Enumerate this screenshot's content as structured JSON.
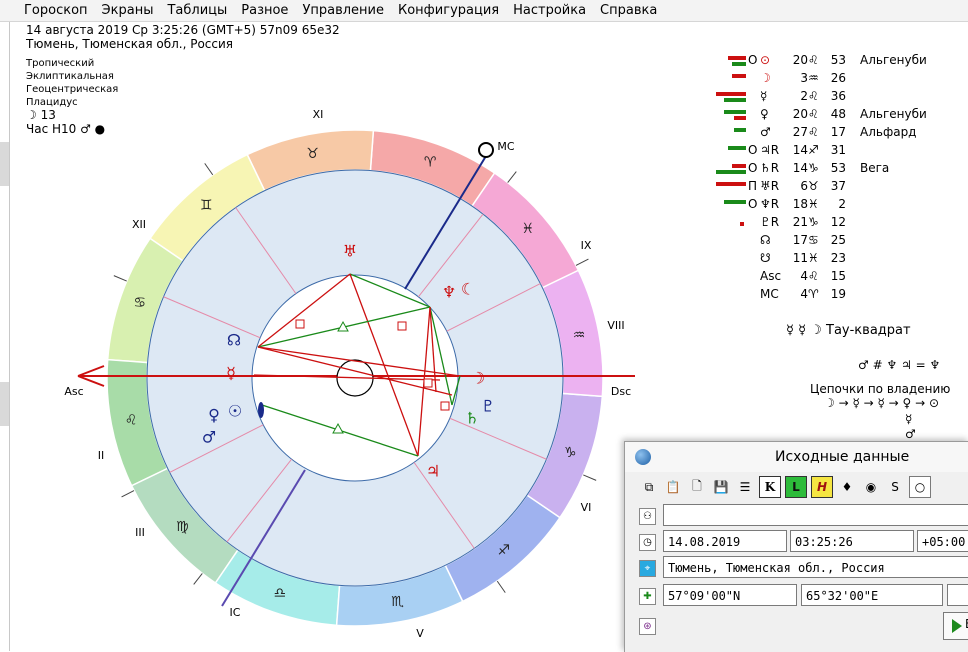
{
  "menu": [
    "Гороскоп",
    "Экраны",
    "Таблицы",
    "Разное",
    "Управление",
    "Конфигурация",
    "Настройка",
    "Справка"
  ],
  "header": {
    "line1": "14 августа 2019  Ср   3:25:26 (GMT+5) 57n09  65e32",
    "line2": "Тюмень, Тюменская обл., Россия"
  },
  "settings": [
    "Тропический",
    "Эклиптикальная",
    "Геоцентрическая",
    "Плацидус"
  ],
  "moon_line": "☽  13",
  "hour_line": "Час Н10  ♂ ●",
  "houses": [
    "XI",
    "XII",
    "IX",
    "VIII",
    "II",
    "III",
    "VI",
    "V",
    "IC",
    "Dsc",
    "Asc",
    "MC"
  ],
  "zodiac": [
    "♈",
    "♉",
    "♊",
    "♋",
    "♌",
    "♍",
    "♎",
    "♏",
    "♐",
    "♑",
    "♒",
    "♓"
  ],
  "chart_planets": [
    "♅R",
    "♆R",
    "☾",
    "☊",
    "☿",
    "♀",
    "☉",
    "♂",
    "♃",
    "♇R",
    "♄R"
  ],
  "colors": {
    "red": "#cc1010",
    "green": "#1a8a1a",
    "blue": "#1a2a8a",
    "inner": "#dfe9f5"
  },
  "planets": [
    {
      "bars": "red+green",
      "mark": "O",
      "sym": "⊙",
      "deg": "20",
      "sign": "♌",
      "min": "53",
      "star": "Альгенуби"
    },
    {
      "bars": "red",
      "mark": "",
      "sym": "☽",
      "deg": "3",
      "sign": "♒",
      "min": "26",
      "star": ""
    },
    {
      "bars": "red+green",
      "mark": "",
      "sym": "☿",
      "deg": "2",
      "sign": "♌",
      "min": "36",
      "star": ""
    },
    {
      "bars": "green+red",
      "mark": "",
      "sym": "♀",
      "deg": "20",
      "sign": "♌",
      "min": "48",
      "star": "Альгенуби"
    },
    {
      "bars": "green",
      "mark": "",
      "sym": "♂",
      "deg": "27",
      "sign": "♌",
      "min": "17",
      "star": "Альфард"
    },
    {
      "bars": "green",
      "mark": "O",
      "sym": "♃R",
      "deg": "14",
      "sign": "♐",
      "min": "31",
      "star": ""
    },
    {
      "bars": "red+green",
      "mark": "O",
      "sym": "♄R",
      "deg": "14",
      "sign": "♑",
      "min": "53",
      "star": "Вега"
    },
    {
      "bars": "red",
      "mark": "П",
      "sym": "♅R",
      "deg": "6",
      "sign": "♉",
      "min": "37",
      "star": ""
    },
    {
      "bars": "green",
      "mark": "O",
      "sym": "♆R",
      "deg": "18",
      "sign": "♓",
      "min": "2",
      "star": ""
    },
    {
      "bars": "dot",
      "mark": "",
      "sym": "♇R",
      "deg": "21",
      "sign": "♑",
      "min": "12",
      "star": ""
    },
    {
      "bars": "",
      "mark": "",
      "sym": "☊",
      "deg": "17",
      "sign": "♋",
      "min": "25",
      "star": ""
    },
    {
      "bars": "",
      "mark": "",
      "sym": "☋",
      "deg": "11",
      "sign": "♓",
      "min": "23",
      "star": ""
    },
    {
      "bars": "",
      "mark": "",
      "sym": "Asc",
      "deg": "4",
      "sign": "♌",
      "min": "15",
      "star": ""
    },
    {
      "bars": "",
      "mark": "",
      "sym": "MC",
      "deg": "4",
      "sign": "♈",
      "min": "19",
      "star": ""
    }
  ],
  "right_notes": {
    "tau_square": "☿ ☿ ☽   Тау-квадрат",
    "mutual": "♂ # ♆  ♃ = ♆",
    "chains_title": "Цепочки по владению",
    "chain": "☽ → ☿ → ☿ → ♀ → ⊙",
    "chain2": "☿",
    "chain3": "♂"
  },
  "dialog": {
    "title": "Исходные данные",
    "date": "14.08.2019",
    "time": "03:25:26",
    "tz": "+05:00",
    "place": "Тюмень, Тюменская обл., Россия",
    "lat": "57°09'00\"N",
    "lon": "65°32'00\"E",
    "ok": "E",
    "tb_k": "K",
    "tb_l": "L",
    "tb_h": "H"
  }
}
